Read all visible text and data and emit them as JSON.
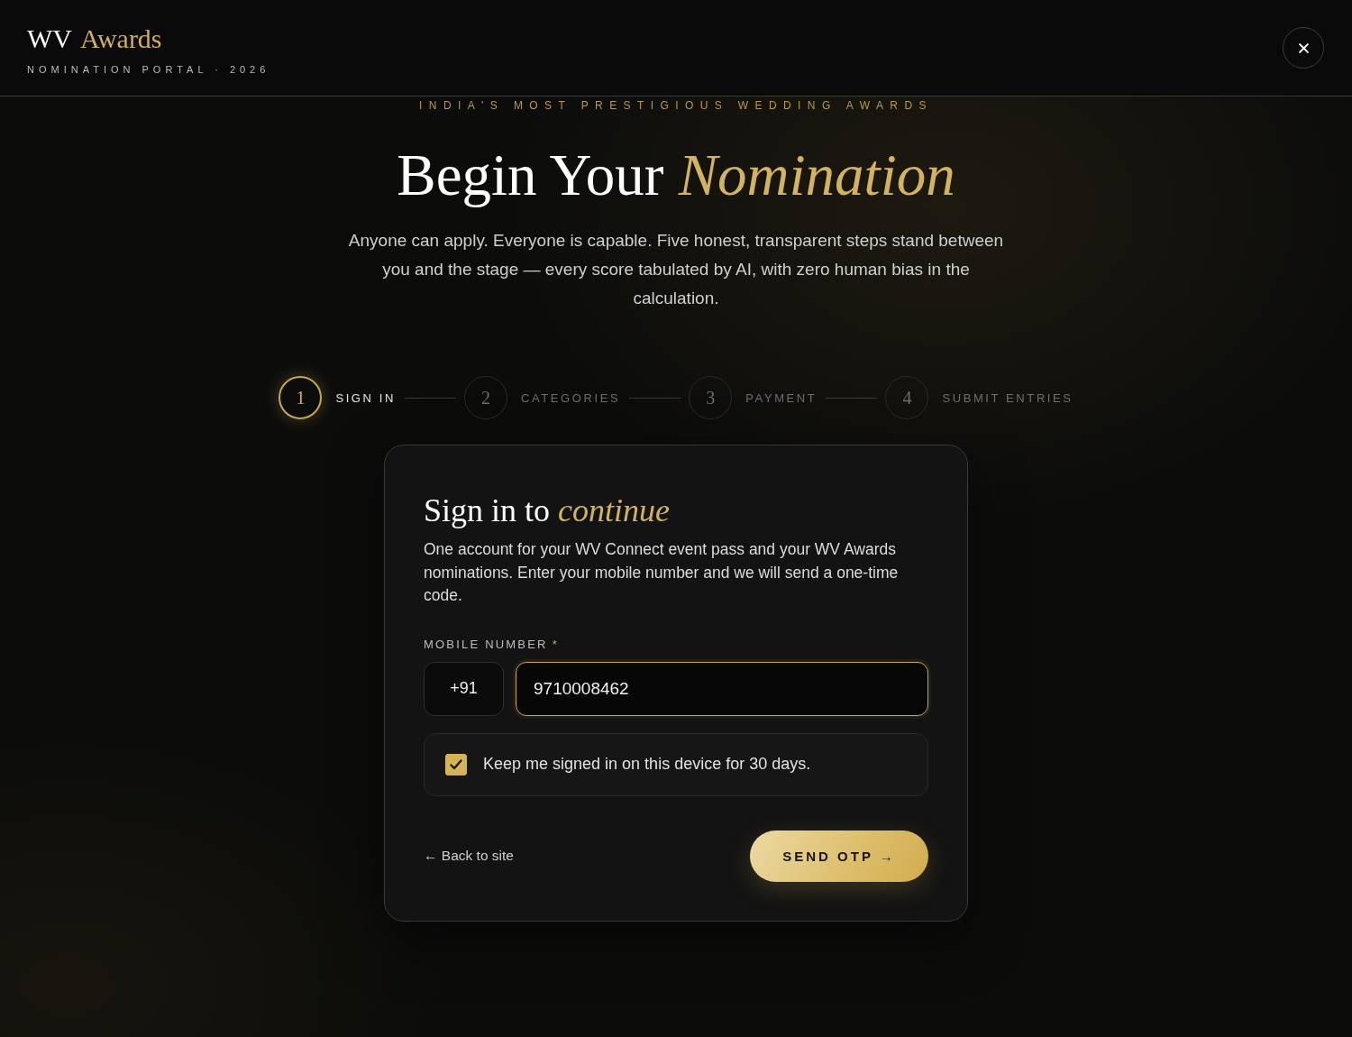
{
  "header": {
    "brand": {
      "name": "WV",
      "accent": "Awards",
      "tagline": "NOMINATION PORTAL · 2026"
    }
  },
  "hero": {
    "kicker": "INDIA'S MOST PRESTIGIOUS WEDDING AWARDS",
    "title": "Begin Your *Nomination*",
    "lead": "Anyone can apply. Everyone is capable. Five honest, transparent steps stand between you and the stage — every score tabulated by AI, with zero human bias in the calculation."
  },
  "steps": [
    {
      "number": "1",
      "label": "SIGN IN",
      "selected": true
    },
    {
      "number": "2",
      "label": "CATEGORIES",
      "selected": false
    },
    {
      "number": "3",
      "label": "PAYMENT",
      "selected": false
    },
    {
      "number": "4",
      "label": "SUBMIT ENTRIES",
      "selected": false
    }
  ],
  "card": {
    "title": "Sign in to *continue*",
    "description": "One account for your WV Connect event pass and your WV Awards nominations. Enter your mobile number and we will send a one-time code.",
    "phone": {
      "label": "MOBILE NUMBER",
      "required_mark": "*",
      "country_code": "+91",
      "value": "9710008462",
      "focused": true
    },
    "remember": {
      "label": "Keep me signed in on this device for 30 days.",
      "checked": true
    },
    "back_link": "← Back to site",
    "submit": "SEND OTP →"
  }
}
